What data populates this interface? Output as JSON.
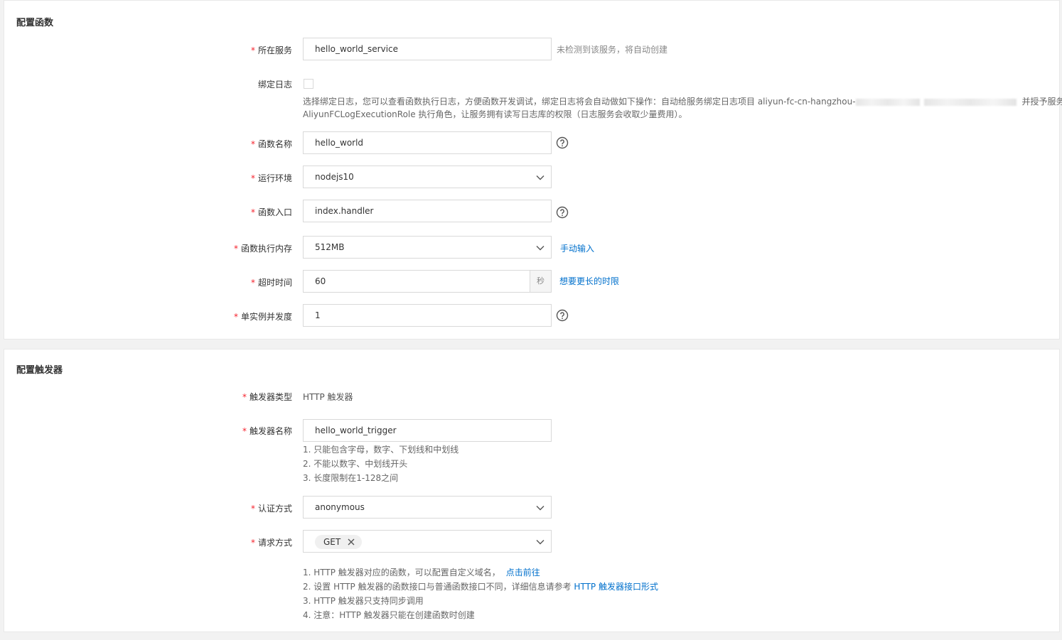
{
  "function_section": {
    "title": "配置函数",
    "service": {
      "label": "所在服务",
      "value": "hello_world_service",
      "note": "未检测到该服务，将自动创建"
    },
    "bind_log": {
      "label": "绑定日志",
      "checked": false,
      "desc_line1_a": "选择绑定日志，您可以查看函数执行日志，方便函数开发调试，绑定日志将会自动做如下操作：自动给服务绑定日志项目 aliyun-fc-cn-hangzhou-",
      "desc_line1_b": "并授予服务",
      "desc_line2": "AliyunFCLogExecutionRole 执行角色，让服务拥有读写日志库的权限（日志服务会收取少量费用）。"
    },
    "function_name": {
      "label": "函数名称",
      "value": "hello_world"
    },
    "runtime": {
      "label": "运行环境",
      "value": "nodejs10"
    },
    "handler": {
      "label": "函数入口",
      "value": "index.handler"
    },
    "memory": {
      "label": "函数执行内存",
      "value": "512MB",
      "link": "手动输入"
    },
    "timeout": {
      "label": "超时时间",
      "value": "60",
      "unit": "秒",
      "link": "想要更长的时限"
    },
    "concurrency": {
      "label": "单实例并发度",
      "value": "1"
    }
  },
  "trigger_section": {
    "title": "配置触发器",
    "trigger_type": {
      "label": "触发器类型",
      "value": "HTTP 触发器"
    },
    "trigger_name": {
      "label": "触发器名称",
      "value": "hello_world_trigger",
      "rules": [
        "1. 只能包含字母，数字、下划线和中划线",
        "2. 不能以数字、中划线开头",
        "3. 长度限制在1-128之间"
      ]
    },
    "auth": {
      "label": "认证方式",
      "value": "anonymous"
    },
    "method": {
      "label": "请求方式",
      "tag": "GET"
    },
    "notes": {
      "n1_text": "1. HTTP 触发器对应的函数，可以配置自定义域名，",
      "n1_link": "点击前往",
      "n2_text": "2. 设置 HTTP 触发器的函数接口与普通函数接口不同，详细信息请参考 ",
      "n2_link": "HTTP 触发器接口形式",
      "n3": "3. HTTP 触发器只支持同步调用",
      "n4": "4. 注意：HTTP 触发器只能在创建函数时创建"
    }
  },
  "icons": {
    "help": "question-circle-icon",
    "dropdown": "chevron-down-icon",
    "close": "close-icon"
  },
  "colors": {
    "required": "#f5222d",
    "link": "#0070cc",
    "border": "#d9d9d9"
  }
}
